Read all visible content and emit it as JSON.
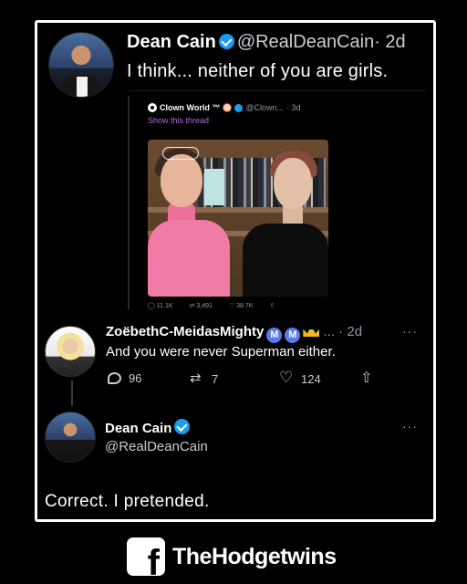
{
  "tweet": {
    "name": "Dean Cain",
    "handle": "@RealDeanCain",
    "age": "· 2d",
    "text": "I think... neither of you are girls."
  },
  "quoted": {
    "account": "Clown World ™",
    "handle": "@Clown...",
    "age": "· 3d",
    "show_thread": "Show this thread",
    "stats": {
      "replies": "11.1K",
      "retweets": "3,491",
      "likes": "38.7K"
    }
  },
  "reply1": {
    "name": "ZoëbethC-MeidasMighty",
    "badge1": "M",
    "badge2": "M",
    "meta": "... · 2d",
    "more": "···",
    "text": "And you were never Superman either.",
    "replies": "96",
    "retweets": "7",
    "likes": "124"
  },
  "reply2": {
    "name": "Dean Cain",
    "handle": "@RealDeanCain",
    "more": "···",
    "text": "Correct. I pretended."
  },
  "footer": {
    "fb_letter": "f",
    "brand": "TheHodgetwins"
  },
  "colors": {
    "verified": "#1d9bf0",
    "background": "#000000",
    "thread_link": "#b46ae0"
  }
}
